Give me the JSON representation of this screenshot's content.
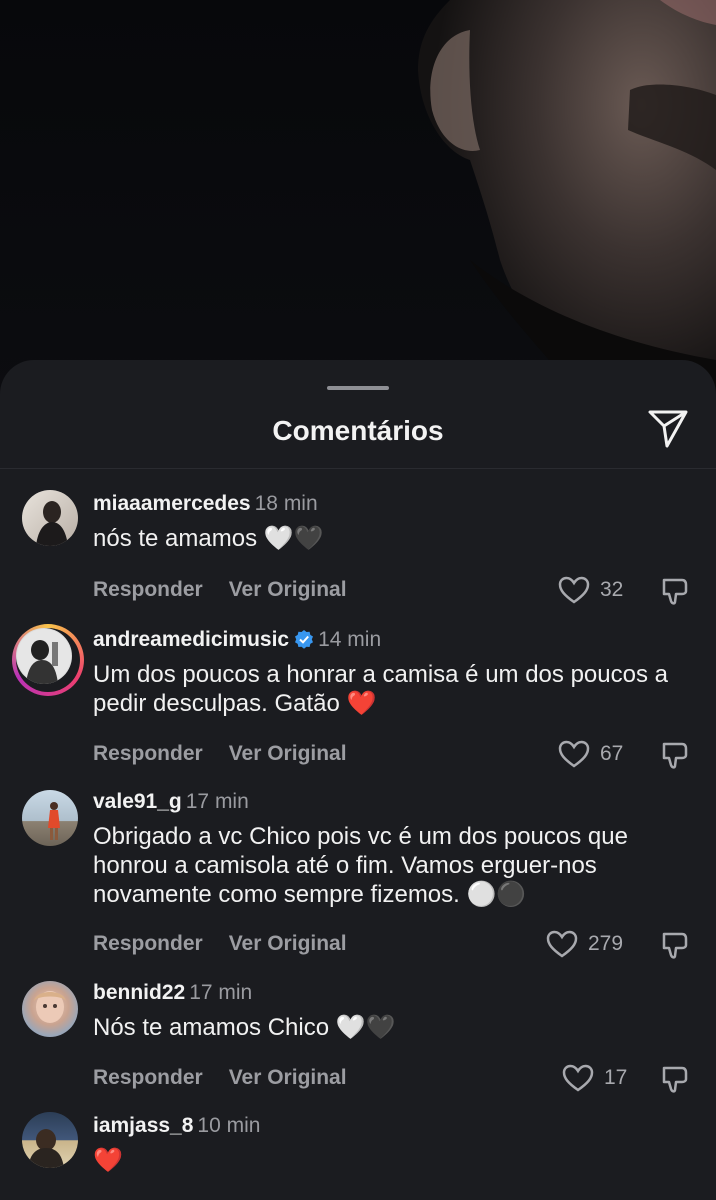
{
  "sheet": {
    "title": "Comentários"
  },
  "actions": {
    "reply": "Responder",
    "original": "Ver Original"
  },
  "comments": [
    {
      "user": "miaaamercedes",
      "time": "18 min",
      "text": "nós te amamos",
      "emoji": "🤍🖤",
      "likes": "32"
    },
    {
      "user": "andreamedicimusic",
      "time": "14 min",
      "text": "Um dos poucos a honrar a camisa é um dos poucos a pedir desculpas. Gatão",
      "emoji": "❤️",
      "likes": "67",
      "verified": true
    },
    {
      "user": "vale91_g",
      "time": "17 min",
      "text": "Obrigado a vc Chico pois vc é um dos poucos que honrou a camisola até o fim. Vamos erguer-nos novamente como sempre fizemos.",
      "emoji": "⚪⚫",
      "likes": "279"
    },
    {
      "user": "bennid22",
      "time": "17 min",
      "text": "Nós te amamos Chico",
      "emoji": "🤍🖤",
      "likes": "17"
    },
    {
      "user": "iamjass_8",
      "time": "10 min",
      "text": "",
      "emoji": "❤️"
    }
  ]
}
